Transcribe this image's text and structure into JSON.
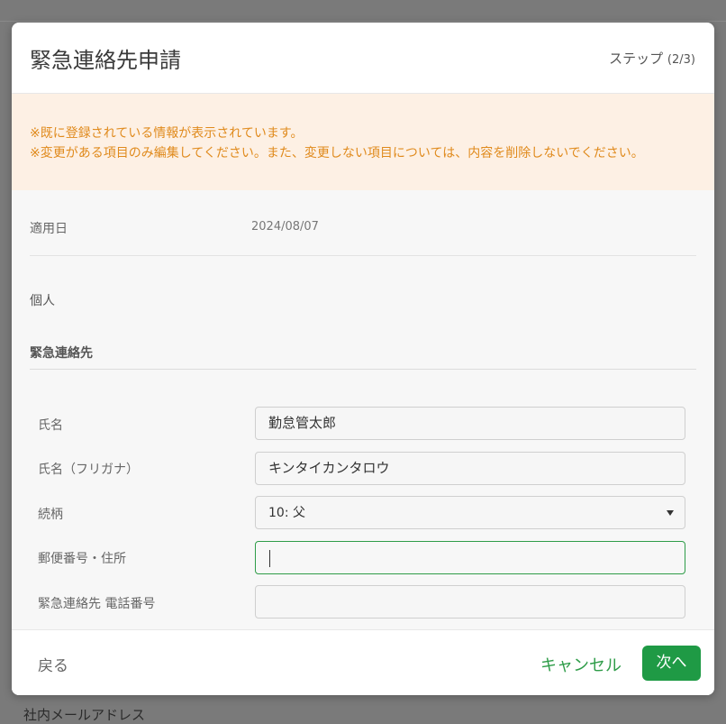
{
  "modal": {
    "title": "緊急連絡先申請",
    "step_prefix": "ステップ ",
    "step_count": "(2/3)"
  },
  "notice": {
    "line1": "※既に登録されている情報が表示されています。",
    "line2": "※変更がある項目のみ編集してください。また、変更しない項目については、内容を削除しないでください。"
  },
  "form": {
    "date_label": "適用日",
    "date_value": "2024/08/07",
    "individual_label": "個人",
    "section_title": "緊急連絡先",
    "name_label": "氏名",
    "name_value": "勤怠管太郎",
    "kana_label": "氏名（フリガナ）",
    "kana_value": "キンタイカンタロウ",
    "relation_label": "続柄",
    "relation_value": "10: 父",
    "address_label": "郵便番号・住所",
    "address_value": "",
    "phone_label": "緊急連絡先 電話番号",
    "phone_value": ""
  },
  "footer": {
    "back_label": "戻る",
    "cancel_label": "キャンセル",
    "next_label": "次へ"
  },
  "background": {
    "bottom_text": "社内メールアドレス"
  },
  "colors": {
    "accent": "#1f9a45",
    "notice_bg": "#fdf0e4",
    "notice_text": "#e08a1c"
  }
}
